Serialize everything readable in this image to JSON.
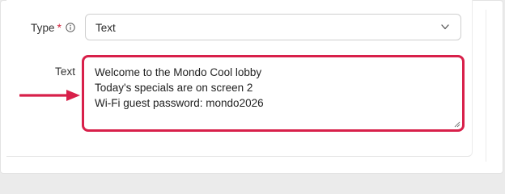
{
  "form": {
    "type_field": {
      "label": "Type",
      "required_mark": "*",
      "info_icon": "info-icon",
      "selected_value": "Text",
      "dropdown_icon": "chevron-down-icon"
    },
    "text_field": {
      "label": "Text",
      "lines": [
        "Welcome to the Mondo Cool lobby",
        "Today's specials are on screen 2",
        "Wi-Fi guest password: mondo2026"
      ],
      "resize_icon": "resize-grip-icon"
    }
  },
  "annotation": {
    "pointer_icon": "arrow-right-icon",
    "highlight_color": "#d8204a"
  }
}
